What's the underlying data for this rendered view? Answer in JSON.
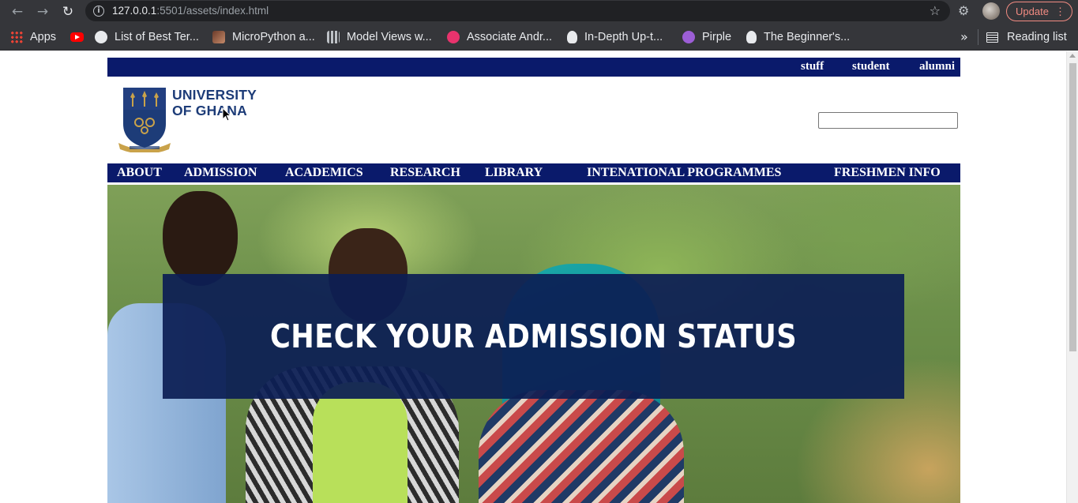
{
  "browser": {
    "url_host": "127.0.0.1",
    "url_rest": ":5501/assets/index.html",
    "update_label": "Update",
    "bookmarks": [
      {
        "label": "Apps",
        "icon": "apps-grid-icon"
      },
      {
        "label": "",
        "icon": "youtube-icon"
      },
      {
        "label": "List of Best Ter...",
        "icon": "bookmark-favicon"
      },
      {
        "label": "MicroPython a...",
        "icon": "bookmark-favicon"
      },
      {
        "label": "Model Views w...",
        "icon": "bookmark-favicon"
      },
      {
        "label": "Associate Andr...",
        "icon": "bookmark-favicon"
      },
      {
        "label": "In-Depth Up-t...",
        "icon": "bookmark-favicon"
      },
      {
        "label": "Pirple",
        "icon": "bookmark-favicon"
      },
      {
        "label": "The Beginner's...",
        "icon": "bookmark-favicon"
      }
    ],
    "more_label": "»",
    "reading_list": "Reading list"
  },
  "site": {
    "topbar": [
      "stuff",
      "student",
      "alumni"
    ],
    "logo": {
      "line1": "UNIVERSITY",
      "line2": "OF GHANA"
    },
    "search_value": "",
    "nav": [
      "ABOUT",
      "ADMISSION",
      "ACADEMICS",
      "RESEARCH",
      "LIBRARY",
      "INTENATIONAL PROGRAMMES",
      "FRESHMEN INFO"
    ],
    "hero_banner": "CHECK YOUR ADMISSION STATUS"
  },
  "colors": {
    "navy": "#0a1a6b",
    "banner": "#0c1e54",
    "logo_blue": "#1d3c78",
    "logo_gold": "#c9a24a"
  }
}
